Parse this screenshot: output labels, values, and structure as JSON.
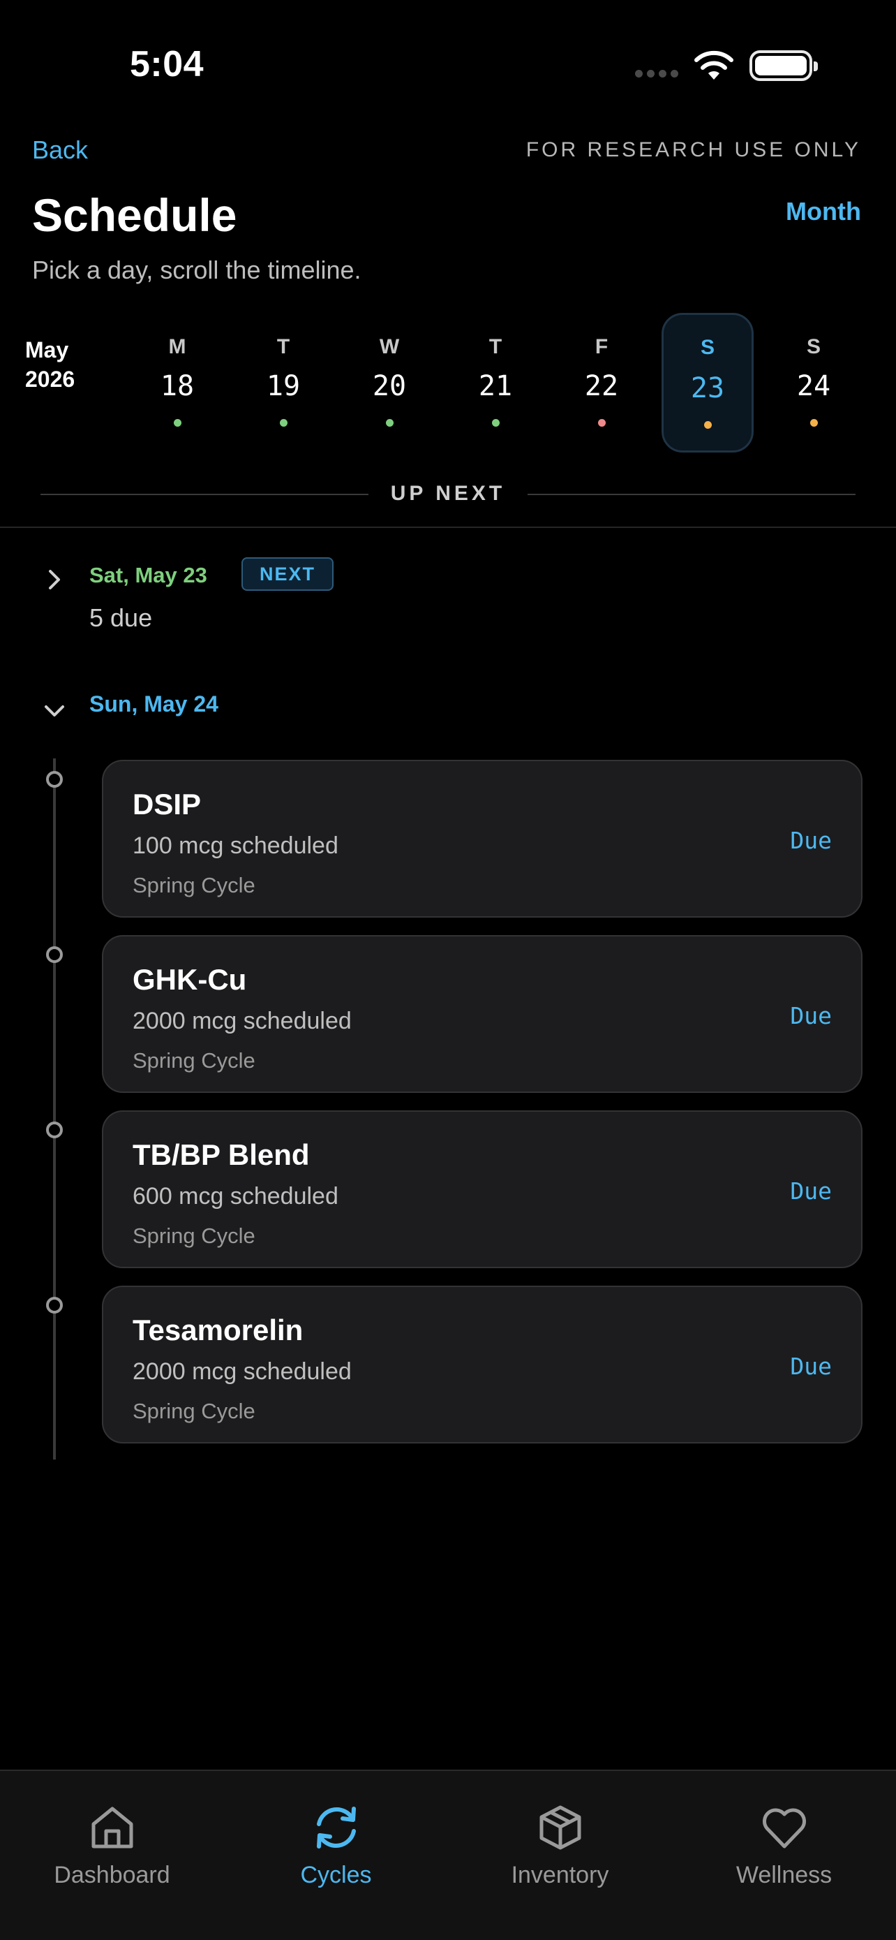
{
  "status_bar": {
    "time": "5:04"
  },
  "header": {
    "back_label": "Back",
    "research_note": "FOR RESEARCH USE ONLY",
    "title": "Schedule",
    "month_button": "Month",
    "subtitle": "Pick a day, scroll the timeline."
  },
  "week": {
    "month": "May",
    "year": "2026",
    "days": [
      {
        "dow": "M",
        "num": "18",
        "dot_color": "#7ed07e"
      },
      {
        "dow": "T",
        "num": "19",
        "dot_color": "#7ed07e"
      },
      {
        "dow": "W",
        "num": "20",
        "dot_color": "#7ed07e"
      },
      {
        "dow": "T",
        "num": "21",
        "dot_color": "#7ed07e"
      },
      {
        "dow": "F",
        "num": "22",
        "dot_color": "#f08a8a"
      },
      {
        "dow": "S",
        "num": "23",
        "dot_color": "#f5b04a",
        "selected": true
      },
      {
        "dow": "S",
        "num": "24",
        "dot_color": "#f5b04a"
      }
    ]
  },
  "up_next_label": "UP NEXT",
  "groups": [
    {
      "date": "Sat, May 23",
      "badge": "NEXT",
      "count": "5 due",
      "expanded": false
    },
    {
      "date": "Sun, May 24",
      "expanded": true
    }
  ],
  "doses": [
    {
      "name": "DSIP",
      "amount": "100 mcg scheduled",
      "cycle": "Spring Cycle",
      "status": "Due"
    },
    {
      "name": "GHK-Cu",
      "amount": "2000 mcg scheduled",
      "cycle": "Spring Cycle",
      "status": "Due"
    },
    {
      "name": "TB/BP Blend",
      "amount": "600 mcg scheduled",
      "cycle": "Spring Cycle",
      "status": "Due"
    },
    {
      "name": "Tesamorelin",
      "amount": "2000 mcg scheduled",
      "cycle": "Spring Cycle",
      "status": "Due"
    }
  ],
  "tabs": [
    {
      "label": "Dashboard",
      "icon": "home-icon"
    },
    {
      "label": "Cycles",
      "icon": "refresh-icon",
      "active": true
    },
    {
      "label": "Inventory",
      "icon": "box-icon"
    },
    {
      "label": "Wellness",
      "icon": "heart-icon"
    }
  ],
  "colors": {
    "accent": "#4db8f0",
    "next_green": "#7ed07e",
    "card_bg": "#1c1c1e"
  }
}
